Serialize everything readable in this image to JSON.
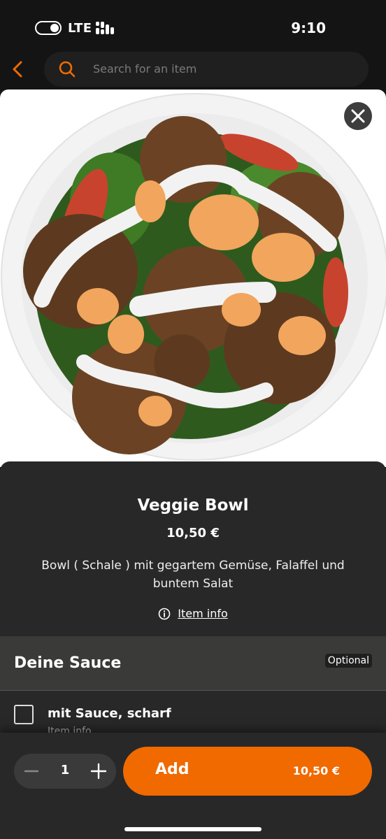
{
  "status_bar": {
    "network": "LTE",
    "time": "9:10"
  },
  "search": {
    "placeholder": "Search for an item"
  },
  "item": {
    "name": "Veggie Bowl",
    "price": "10,50 €",
    "description": "Bowl ( Schale ) mit gegartem Gemüse, Falaffel und buntem Salat",
    "info_link": "Item info"
  },
  "sauce_section": {
    "title": "Deine Sauce",
    "badge": "Optional",
    "options": [
      {
        "label": "mit Sauce, scharf",
        "sub": "Item info",
        "checked": false
      }
    ]
  },
  "cart": {
    "quantity": "1",
    "add_label": "Add",
    "add_price": "10,50 €"
  },
  "colors": {
    "accent": "#f06a00",
    "background": "#141414",
    "panel": "#282828"
  }
}
